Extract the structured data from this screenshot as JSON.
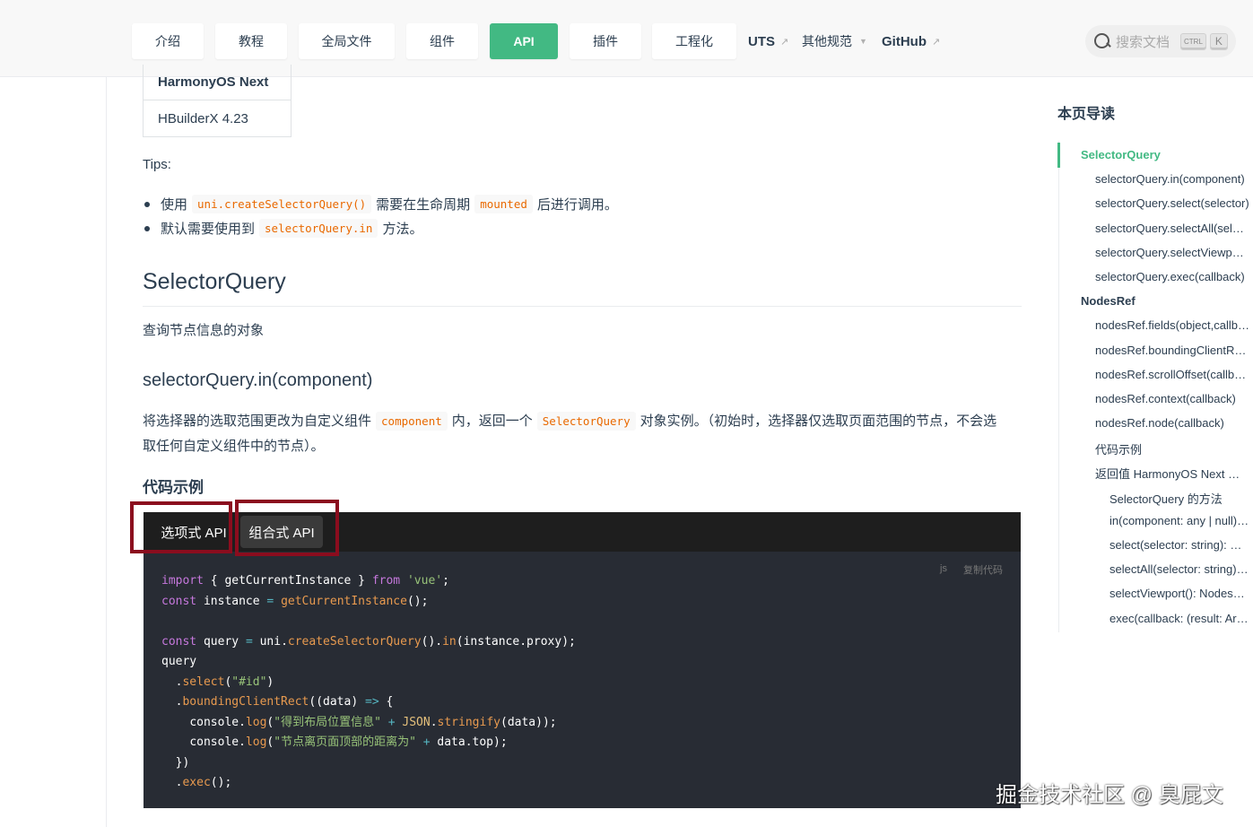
{
  "navbar": {
    "buttons": [
      "介绍",
      "教程",
      "全局文件",
      "组件",
      "API",
      "插件",
      "工程化"
    ],
    "active": "API",
    "links": {
      "uts": "UTS",
      "other_specs": "其他规范",
      "github": "GitHub"
    },
    "search": {
      "placeholder": "搜索文档",
      "kbd_ctrl": "CTRL",
      "kbd_k": "K"
    }
  },
  "platform_table": {
    "header": "HarmonyOS Next",
    "value": "HBuilderX 4.23"
  },
  "tips": {
    "label": "Tips:",
    "items": [
      {
        "pre": "使用",
        "code": "uni.createSelectorQuery()",
        "mid": "需要在生命周期",
        "code2": "mounted",
        "post": "后进行调用。"
      },
      {
        "pre": "默认需要使用到",
        "code": "selectorQuery.in",
        "post": "方法。"
      }
    ]
  },
  "section": {
    "title": "SelectorQuery",
    "desc": "查询节点信息的对象",
    "method_title": "selectorQuery.in(component)",
    "method_desc_pre": "将选择器的选取范围更改为自定义组件",
    "method_desc_code1": "component",
    "method_desc_mid": "内，返回一个",
    "method_desc_code2": "SelectorQuery",
    "method_desc_post": "对象实例。（初始时，选择器仅选取页面范围的节点，不会选取任何自定义组件中的节点）。",
    "example_title": "代码示例"
  },
  "code_block": {
    "tabs": [
      "选项式 API",
      "组合式 API"
    ],
    "active_tab": "组合式 API",
    "lang": "js",
    "copy_label": "复制代码",
    "lines": [
      "import { getCurrentInstance } from 'vue';",
      "const instance = getCurrentInstance();",
      "",
      "const query = uni.createSelectorQuery().in(instance.proxy);",
      "query",
      "  .select(\"#id\")",
      "  .boundingClientRect((data) => {",
      "    console.log(\"得到布局位置信息\" + JSON.stringify(data));",
      "    console.log(\"节点离页面顶部的距离为\" + data.top);",
      "  })",
      "  .exec();"
    ]
  },
  "toc": {
    "title": "本页导读",
    "items": [
      {
        "label": "SelectorQuery",
        "level": 1,
        "active": true
      },
      {
        "label": "selectorQuery.in(component)",
        "level": 2
      },
      {
        "label": "selectorQuery.select(selector)",
        "level": 2
      },
      {
        "label": "selectorQuery.selectAll(selector)",
        "level": 2
      },
      {
        "label": "selectorQuery.selectViewport()",
        "level": 2
      },
      {
        "label": "selectorQuery.exec(callback)",
        "level": 2
      },
      {
        "label": "NodesRef",
        "level": 1
      },
      {
        "label": "nodesRef.fields(object,callback)",
        "level": 2
      },
      {
        "label": "nodesRef.boundingClientRect(callback)",
        "level": 2
      },
      {
        "label": "nodesRef.scrollOffset(callback)",
        "level": 2
      },
      {
        "label": "nodesRef.context(callback)",
        "level": 2
      },
      {
        "label": "nodesRef.node(callback)",
        "level": 2
      },
      {
        "label": "代码示例",
        "level": 2
      },
      {
        "label": "返回值 HarmonyOS Next 兼容性",
        "level": 2
      },
      {
        "label": "SelectorQuery 的方法",
        "level": 3
      },
      {
        "label": "in(component: any | null): SelectorQuery",
        "level": 3
      },
      {
        "label": "select(selector: string): NodesRef",
        "level": 3
      },
      {
        "label": "selectAll(selector: string): NodesRef",
        "level": 3
      },
      {
        "label": "selectViewport(): NodesRef",
        "level": 3
      },
      {
        "label": "exec(callback: (result: Array<any>) => void)",
        "level": 3
      }
    ]
  },
  "watermark": "掘金技术社区 @ 臭屁文"
}
